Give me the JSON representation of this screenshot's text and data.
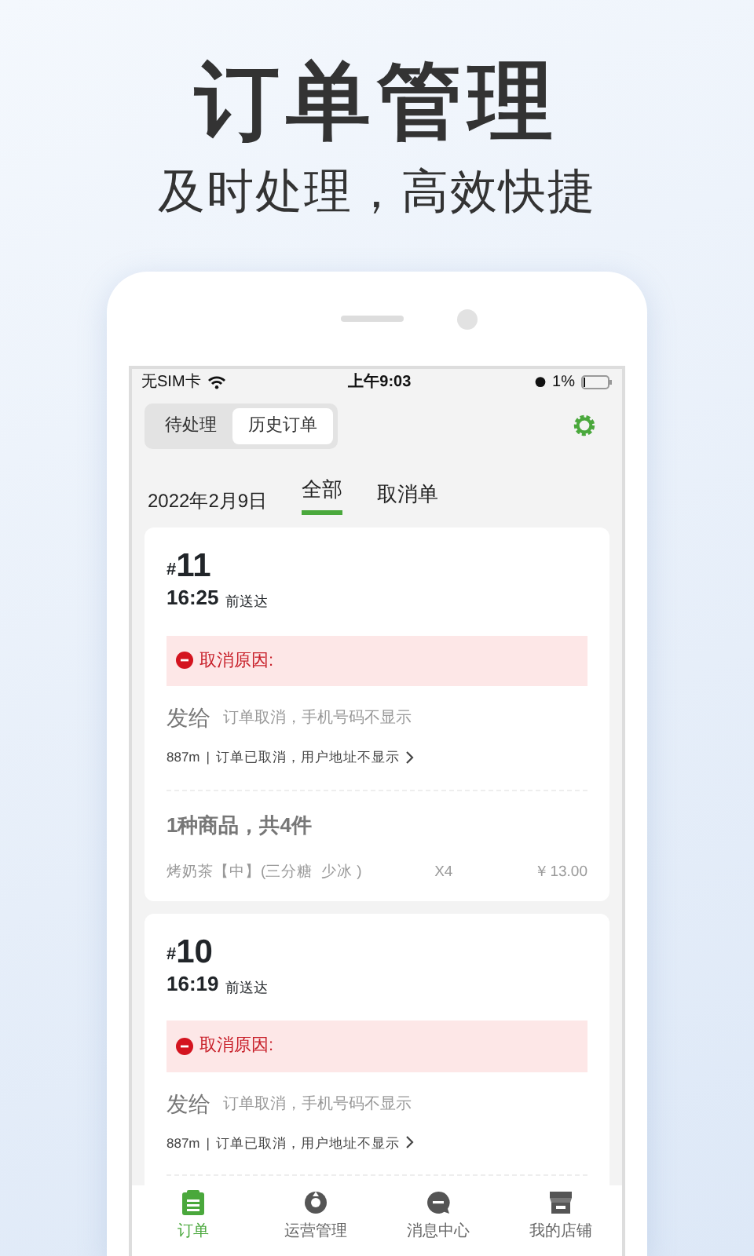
{
  "headline": "订单管理",
  "subheadline": "及时处理，高效快捷",
  "status_bar": {
    "carrier": "无SIM卡",
    "time": "上午9:03",
    "battery": "1%"
  },
  "segments": [
    {
      "label": "待处理",
      "selected": false
    },
    {
      "label": "历史订单",
      "selected": true
    }
  ],
  "date": "2022年2月9日",
  "filters": [
    {
      "label": "全部",
      "selected": true
    },
    {
      "label": "取消单",
      "selected": false
    }
  ],
  "orders": [
    {
      "hash": "#",
      "number": "11",
      "time": "16:25",
      "time_note": "前送达",
      "cancel_label": "取消原因:",
      "recipient_label": "发给",
      "recipient_note": "订单取消，手机号码不显示",
      "distance": "887m",
      "separator": "|",
      "address": "订单已取消，用户地址不显示",
      "goods_summary": "1种商品，共4件",
      "items": [
        {
          "name": "烤奶茶【中】(三分糖  少冰 )",
          "qty": "X4",
          "price": "￥13.00"
        }
      ]
    },
    {
      "hash": "#",
      "number": "10",
      "time": "16:19",
      "time_note": "前送达",
      "cancel_label": "取消原因:",
      "recipient_label": "发给",
      "recipient_note": "订单取消，手机号码不显示",
      "distance": "887m",
      "separator": "|",
      "address": "订单已取消，用户地址不显示"
    }
  ],
  "nav": [
    {
      "label": "订单",
      "selected": true
    },
    {
      "label": "运营管理",
      "selected": false
    },
    {
      "label": "消息中心",
      "selected": false
    },
    {
      "label": "我的店铺",
      "selected": false
    }
  ]
}
